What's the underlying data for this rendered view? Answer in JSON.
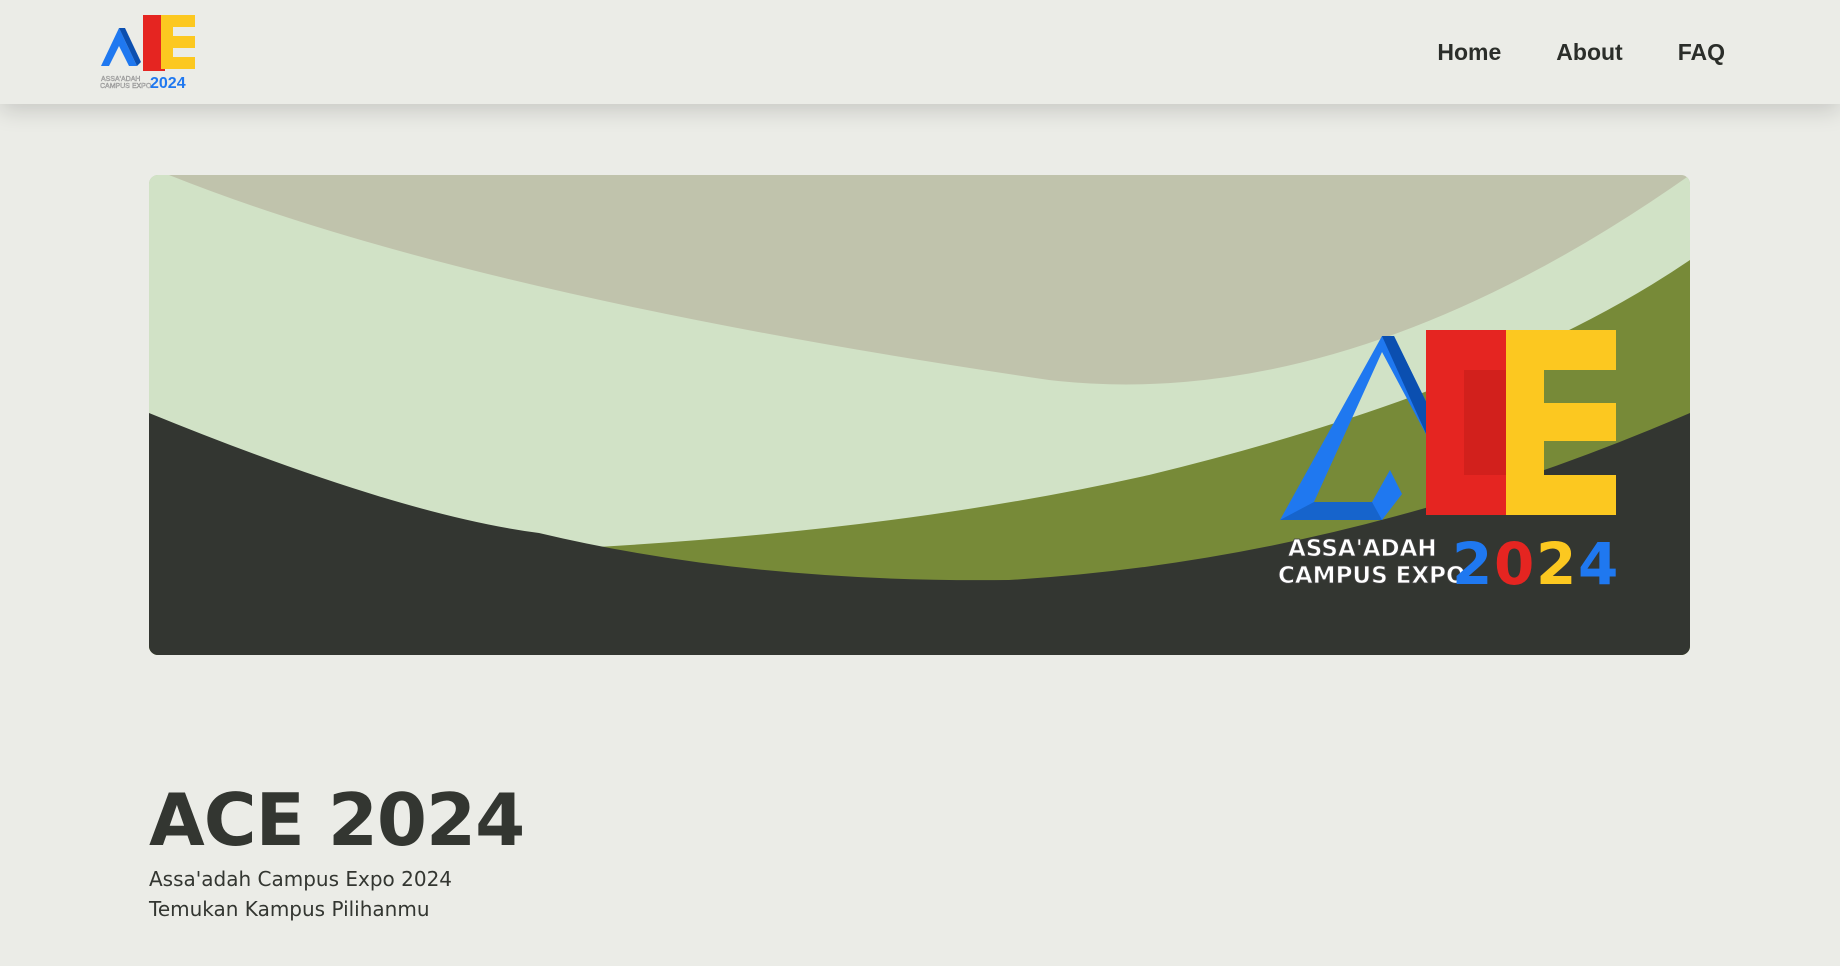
{
  "nav": {
    "logo": {
      "small_text_line1": "ASSA'ADAH",
      "small_text_line2": "CAMPUS EXPO",
      "year": "2024"
    },
    "links": [
      "Home",
      "About",
      "FAQ"
    ]
  },
  "hero": {
    "logo": {
      "text_line1": "ASSA'ADAH",
      "text_line2": "CAMPUS EXPO",
      "year_digits": [
        "2",
        "0",
        "2",
        "4"
      ]
    }
  },
  "intro": {
    "title": "ACE 2024",
    "subtitle": "Assa'adah Campus Expo 2024",
    "tagline": "Temukan Kampus Pilihanmu"
  },
  "colors": {
    "background": "#ebece7",
    "hero_top": "#c0c3ac",
    "hero_light_green": "#d1e2c6",
    "hero_olive": "#778a38",
    "hero_dark": "#333631",
    "logo_blue": "#1f78f0",
    "logo_red": "#e52521",
    "logo_yellow": "#fcc820"
  }
}
